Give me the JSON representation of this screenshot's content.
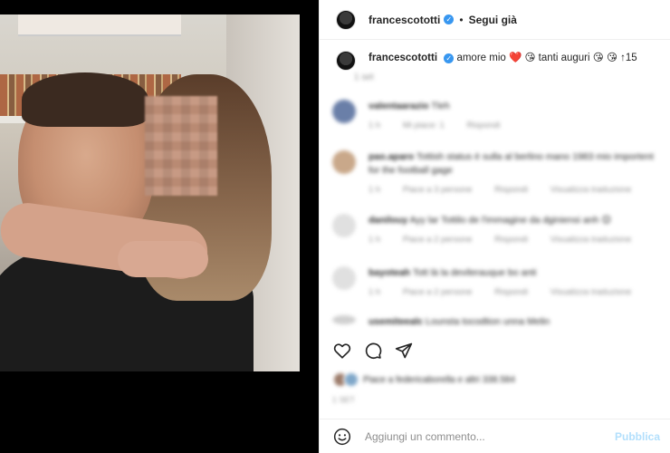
{
  "post": {
    "username": "francescototti",
    "follow_label": "Segui già",
    "separator": "•"
  },
  "caption": {
    "username": "francescototti",
    "text": "amore mio ❤️ 😘 tanti auguri 😘 😘 ↑15",
    "time": "1 set"
  },
  "comments": [
    {
      "user": "valentaarazio",
      "text": "Tleh",
      "meta": [
        "1 h",
        "Mi piace: 1",
        "Rispondi"
      ],
      "avatar_color": "#6a7fa8"
    },
    {
      "user": "pao.aparo",
      "text": "Tottish status è sulla al berlino mano 1983 mio importent for the football gage",
      "meta": [
        "1 h",
        "Piace a 3 persone",
        "Rispondi",
        "Visualizza traduzione"
      ],
      "avatar_color": "#c9a88a"
    },
    {
      "user": "danilouy",
      "text": "Ayy lar Tottilo de l'immagine da dginiensi anh 😊",
      "meta": [
        "1 h",
        "Piace a 2 persone",
        "Rispondi",
        "Visualizza traduzione"
      ],
      "avatar_color": "#e0e0e0"
    },
    {
      "user": "bayoteah",
      "text": "Tott là la devilerauque bo anti",
      "meta": [
        "1 h",
        "Piace a 2 persone",
        "Rispondi",
        "Visualizza traduzione"
      ],
      "avatar_color": "#e0e0e0"
    },
    {
      "user": "usemiteealc",
      "text": "Lounsta tocodtion unna Melin",
      "meta": [],
      "avatar_color": "#cfcfcf"
    }
  ],
  "likes": {
    "text": "Piace a federicaborella e altri 338.584"
  },
  "date": "1 SET",
  "composer": {
    "placeholder": "Aggiungi un commento...",
    "publish_label": "Pubblica"
  },
  "icons": {
    "like": "heart-icon",
    "comment": "comment-bubble-icon",
    "share": "paper-plane-icon",
    "emoji": "emoji-smiley-icon",
    "verified": "verified-badge-icon"
  },
  "colors": {
    "verified": "#3897f0",
    "publish_disabled": "#b2dffc",
    "secondary_text": "#8e8e8e"
  }
}
